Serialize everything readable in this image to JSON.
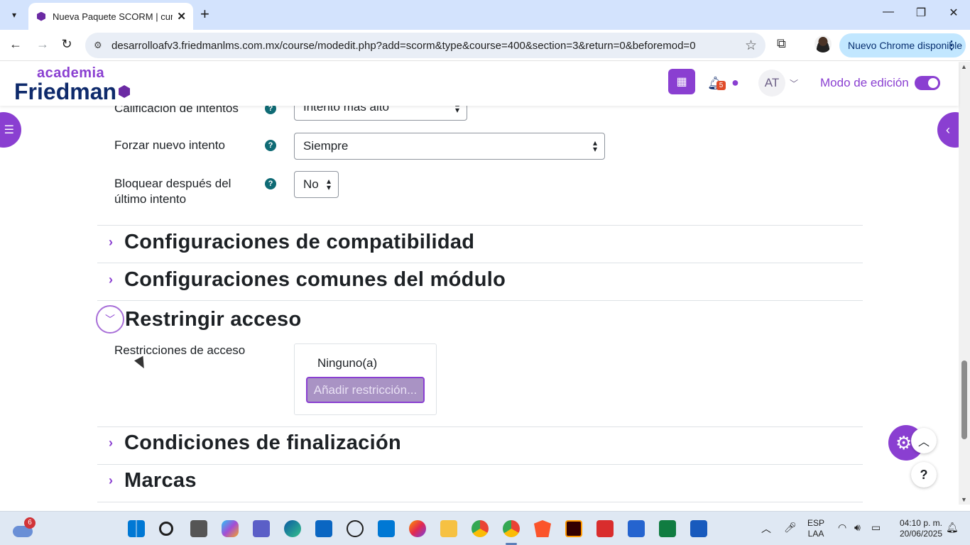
{
  "browser": {
    "tab_title": "Nueva Paquete SCORM | curso",
    "tab_close": "✕",
    "new_tab": "+",
    "url": "desarrolloafv3.friedmanlms.com.mx/course/modedit.php?add=scorm&type&course=400&section=3&return=0&beforemod=0",
    "chrome_update": "Nuevo Chrome disponible",
    "win_min": "—",
    "win_restore": "❐",
    "win_close": "✕"
  },
  "header": {
    "logo_top": "academia",
    "logo_main": "Friedman",
    "notifications_count": "5",
    "avatar_initials": "AT",
    "edit_mode_label": "Modo de edición",
    "edit_mode_on": true
  },
  "form": {
    "rows": [
      {
        "label": "Calificación de intentos",
        "value": "Intento más alto"
      },
      {
        "label": "Forzar nuevo intento",
        "value": "Siempre"
      },
      {
        "label": "Bloquear después del último intento",
        "value": "No"
      }
    ],
    "sections": {
      "compat": "Configuraciones de compatibilidad",
      "common": "Configuraciones comunes del módulo",
      "restrict": "Restringir acceso",
      "completion": "Condiciones de finalización",
      "tags": "Marcas"
    },
    "restrictions_label": "Restricciones de acceso",
    "restrictions_none": "Ninguno(a)",
    "add_restriction_button": "Añadir restricción..."
  },
  "taskbar": {
    "weather_badge": "6",
    "language": "ESP",
    "language_sub": "LAA",
    "time": "04:10 p. m.",
    "date": "20/06/2025"
  },
  "colors": {
    "accent": "#8a3fd1",
    "navy": "#0e2a6b",
    "help_teal": "#0f6b75"
  }
}
